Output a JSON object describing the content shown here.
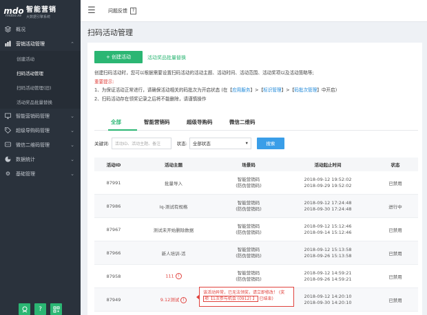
{
  "brand": {
    "mark": "mdo",
    "mark_sub": "midoo.xe",
    "title": "智能营销",
    "subtitle": "大数据引擎系统"
  },
  "sidebar": {
    "items": [
      {
        "label": "概况",
        "icon": "dashboard-icon"
      },
      {
        "label": "营销活动管理",
        "icon": "bar-chart-icon"
      },
      {
        "label": "智能营销码管理",
        "icon": "monitor-icon"
      },
      {
        "label": "超级导购码管理",
        "icon": "tag-icon"
      },
      {
        "label": "微信二维码管理",
        "icon": "wechat-icon"
      },
      {
        "label": "数据统计",
        "icon": "pie-chart-icon"
      },
      {
        "label": "基础管理",
        "icon": "gear-icon"
      }
    ],
    "sub_items": [
      "创建活动",
      "扫码活动管理",
      "扫码活动管理(旧)",
      "活动奖品批量替换"
    ]
  },
  "topbar": {
    "feedback": "问题反馈"
  },
  "page": {
    "title": "扫码活动管理",
    "create_button": "+ 创建活动",
    "batch_link": "活动奖品批量替换"
  },
  "info": {
    "line1": "创建扫码活动时，您可以根据需要设置扫码活动的活动主题、活动时间、活动范围、活动奖项以及活动策略等;",
    "warn": "重要提示:",
    "line2_prefix": "1、为保证活动正常进行，请确保活动相关的码批次为开启状态 (在【",
    "line2_link1": "应用服务",
    "line2_sep1": "】>【",
    "line2_link2": "标识管理",
    "line2_sep2": "】>【",
    "line2_link3": "码批次管理",
    "line2_suffix": "】中开启)",
    "line3": "2、扫码活动存在领奖记录之后将不能删除，请谨慎操作"
  },
  "tabs": [
    "全部",
    "智能营销码",
    "超级导购码",
    "微信二维码"
  ],
  "filters": {
    "keyword_label": "关键词:",
    "keyword_placeholder": "活动ID、活动主题、备注",
    "status_label": "状态:",
    "status_value": "全部状态",
    "search_button": "搜索"
  },
  "table": {
    "headers": [
      "活动ID",
      "活动主题",
      "场景码",
      "活动起止时间",
      "状态"
    ],
    "rows": [
      {
        "id": "87991",
        "topic": "批量导入",
        "code1": "智能营销码",
        "code2": "(防伪营销码)",
        "start": "2018-09-12 19:52:02",
        "end": "2018-09-29 19:52:02",
        "status": "已禁用",
        "alert": false
      },
      {
        "id": "87986",
        "topic": "Iq-测试有规格",
        "code1": "智能营销码",
        "code2": "(防伪营销码)",
        "start": "2018-09-12 17:24:48",
        "end": "2018-09-30 17:24:48",
        "status": "进行中",
        "alert": false
      },
      {
        "id": "87967",
        "topic": "测试未开始删除数据",
        "code1": "智能营销码",
        "code2": "(防伪营销码)",
        "start": "2018-09-12 15:12:46",
        "end": "2018-09-14 15:12:46",
        "status": "已禁用",
        "alert": false
      },
      {
        "id": "87966",
        "topic": "新人培训-活",
        "code1": "智能营销码",
        "code2": "(防伪营销码)",
        "start": "2018-09-12 15:13:58",
        "end": "2018-09-26 15:13:58",
        "status": "已禁用",
        "alert": false
      },
      {
        "id": "87958",
        "topic": "111",
        "code1": "智能营销码",
        "code2": "(防伪营销码)",
        "start": "2018-09-12 14:59:21",
        "end": "2018-09-26 14:59:21",
        "status": "已禁用",
        "alert": true
      },
      {
        "id": "87949",
        "topic": "9.12测试",
        "code1": "",
        "code2": "",
        "start": "2018-09-12 14:20:10",
        "end": "2018-09-30 14:20:10",
        "status": "已禁用",
        "alert": true
      }
    ]
  },
  "tooltip": {
    "line1": "该活动异常，已无法领奖，请立即修改！ (奖",
    "line2_box": "项【1次参与机会 (0912) 】",
    "line2_rest": "已结束)"
  },
  "colors": {
    "accent": "#2bb673",
    "sidebar_bg": "#2a323c",
    "alert": "#e0413c",
    "link": "#1a86d8"
  }
}
